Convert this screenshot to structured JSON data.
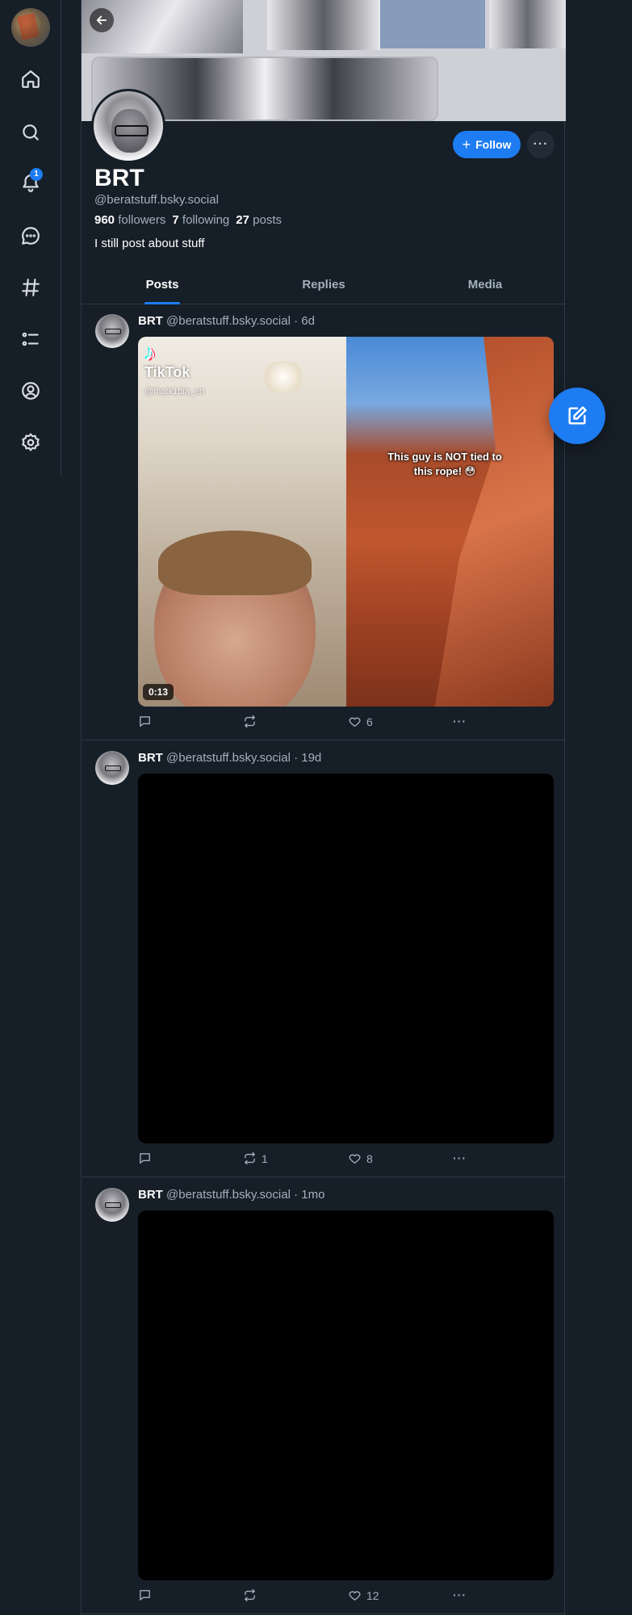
{
  "nav": {
    "items": [
      {
        "name": "home-icon"
      },
      {
        "name": "search-icon"
      },
      {
        "name": "bell-icon"
      },
      {
        "name": "chat-icon"
      },
      {
        "name": "hashtag-icon"
      },
      {
        "name": "lists-icon"
      },
      {
        "name": "profile-icon"
      },
      {
        "name": "settings-icon"
      }
    ],
    "notification_count": "1"
  },
  "profile": {
    "display_name": "BRT",
    "handle": "@beratstuff.bsky.social",
    "followers_count": "960",
    "followers_label": "followers",
    "following_count": "7",
    "following_label": "following",
    "posts_count": "27",
    "posts_label": "posts",
    "bio": "I still post about stuff",
    "follow_label": "Follow",
    "follow_icon": "+",
    "more_label": "···"
  },
  "tabs": [
    {
      "label": "Posts",
      "active": true
    },
    {
      "label": "Replies",
      "active": false
    },
    {
      "label": "Media",
      "active": false
    }
  ],
  "posts": [
    {
      "author": "BRT",
      "handle": "@beratstuff.bsky.social",
      "time": "· 6d",
      "media": {
        "tiktok_brand": "TikTok",
        "tiktok_user": "@thatk1dia_en",
        "caption": "This guy is NOT tied to this rope! 😳",
        "duration": "0:13"
      },
      "replies": "",
      "reposts": "",
      "likes": "6"
    },
    {
      "author": "BRT",
      "handle": "@beratstuff.bsky.social",
      "time": "· 19d",
      "replies": "",
      "reposts": "1",
      "likes": "8"
    },
    {
      "author": "BRT",
      "handle": "@beratstuff.bsky.social",
      "time": "· 1mo",
      "replies": "",
      "reposts": "",
      "likes": "12"
    }
  ],
  "actions": {
    "menu_label": "···"
  },
  "colors": {
    "accent": "#1d7cf2",
    "background": "#161e27",
    "border": "#2e3a47",
    "muted_text": "#a3b0bd"
  }
}
